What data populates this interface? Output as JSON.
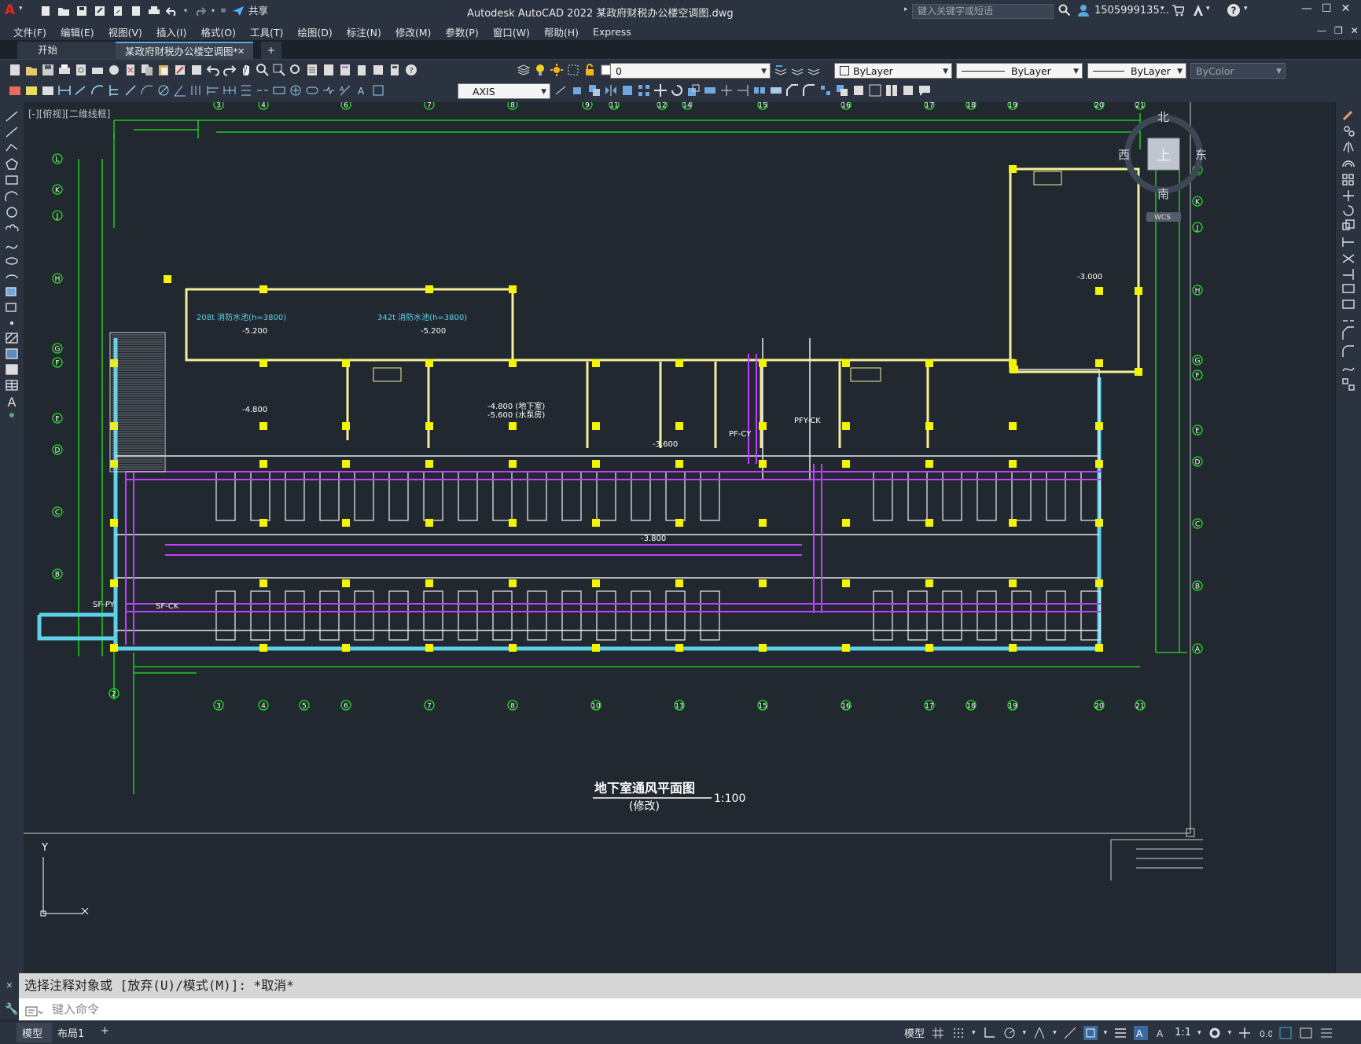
{
  "app": {
    "title": "Autodesk AutoCAD 2022    某政府财税办公楼空调图.dwg",
    "share_label": "共享",
    "search_placeholder": "键入关键字或短语",
    "user_name": "1505999135..."
  },
  "menu": [
    "文件(F)",
    "编辑(E)",
    "视图(V)",
    "插入(I)",
    "格式(O)",
    "工具(T)",
    "绘图(D)",
    "标注(N)",
    "修改(M)",
    "参数(P)",
    "窗口(W)",
    "帮助(H)",
    "Express"
  ],
  "tabs": {
    "start": "开始",
    "active": "某政府财税办公楼空调图*",
    "add": "+"
  },
  "toolbar": {
    "layer_value": "0",
    "color_value": "ByLayer",
    "linetype_value": "ByLayer",
    "lineweight_value": "ByLayer",
    "plotstyle_value": "ByColor",
    "dimstyle_value": "AXIS"
  },
  "viewport_label": "[-][俯视][二维线框]",
  "drawing": {
    "title": "地下室通风平面图",
    "subtitle": "(修改)",
    "scale": "1:100",
    "room_labels": {
      "tank1": "208t 消防水池(h=3800)",
      "tank2": "342t 消防水池(h=3800)",
      "elev1": "-5.200",
      "elev2": "-5.200",
      "elev3": "-4.800",
      "elev4": "-4.800 (地下室)",
      "elev5": "-5.600 (水泵房)",
      "elev6": "-3.600",
      "elev7": "-3.800",
      "elev8": "-3.000",
      "pf": "PF-CY",
      "sf": "SF-PY",
      "sfck": "SF-CK",
      "pfx": "PFY-CK"
    },
    "top_axes": [
      "3",
      "4",
      "6",
      "7",
      "8",
      "9",
      "11",
      "12",
      "14",
      "15",
      "16",
      "17",
      "18",
      "19",
      "20",
      "21"
    ],
    "bottom_axes": [
      "2",
      "3",
      "4",
      "5",
      "6",
      "7",
      "8",
      "10",
      "13",
      "15",
      "16",
      "17",
      "18",
      "19",
      "20",
      "21"
    ],
    "left_axes": [
      "L",
      "K",
      "J",
      "H",
      "G",
      "F",
      "E",
      "D",
      "C",
      "B"
    ],
    "right_axes": [
      "L",
      "K",
      "J",
      "H",
      "G",
      "F",
      "E",
      "D",
      "C",
      "B",
      "A"
    ]
  },
  "viewcube": {
    "north": "北",
    "south": "南",
    "east": "东",
    "west": "西",
    "top": "上",
    "wcs": "WCS"
  },
  "command": {
    "history": "选择注释对象或 [放弃(U)/模式(M)]: *取消*",
    "input_placeholder": "键入命令"
  },
  "status": {
    "model_tab": "模型",
    "layout_tab": "布局1",
    "add": "+",
    "model_label": "模型",
    "scale": "1:1"
  },
  "colors": {
    "wall": "#f5f09a",
    "axis_green": "#19e619",
    "duct_magenta": "#c040ff",
    "column_yellow": "#f4f400",
    "cyan": "#5fd0e8",
    "white": "#ffffff"
  }
}
